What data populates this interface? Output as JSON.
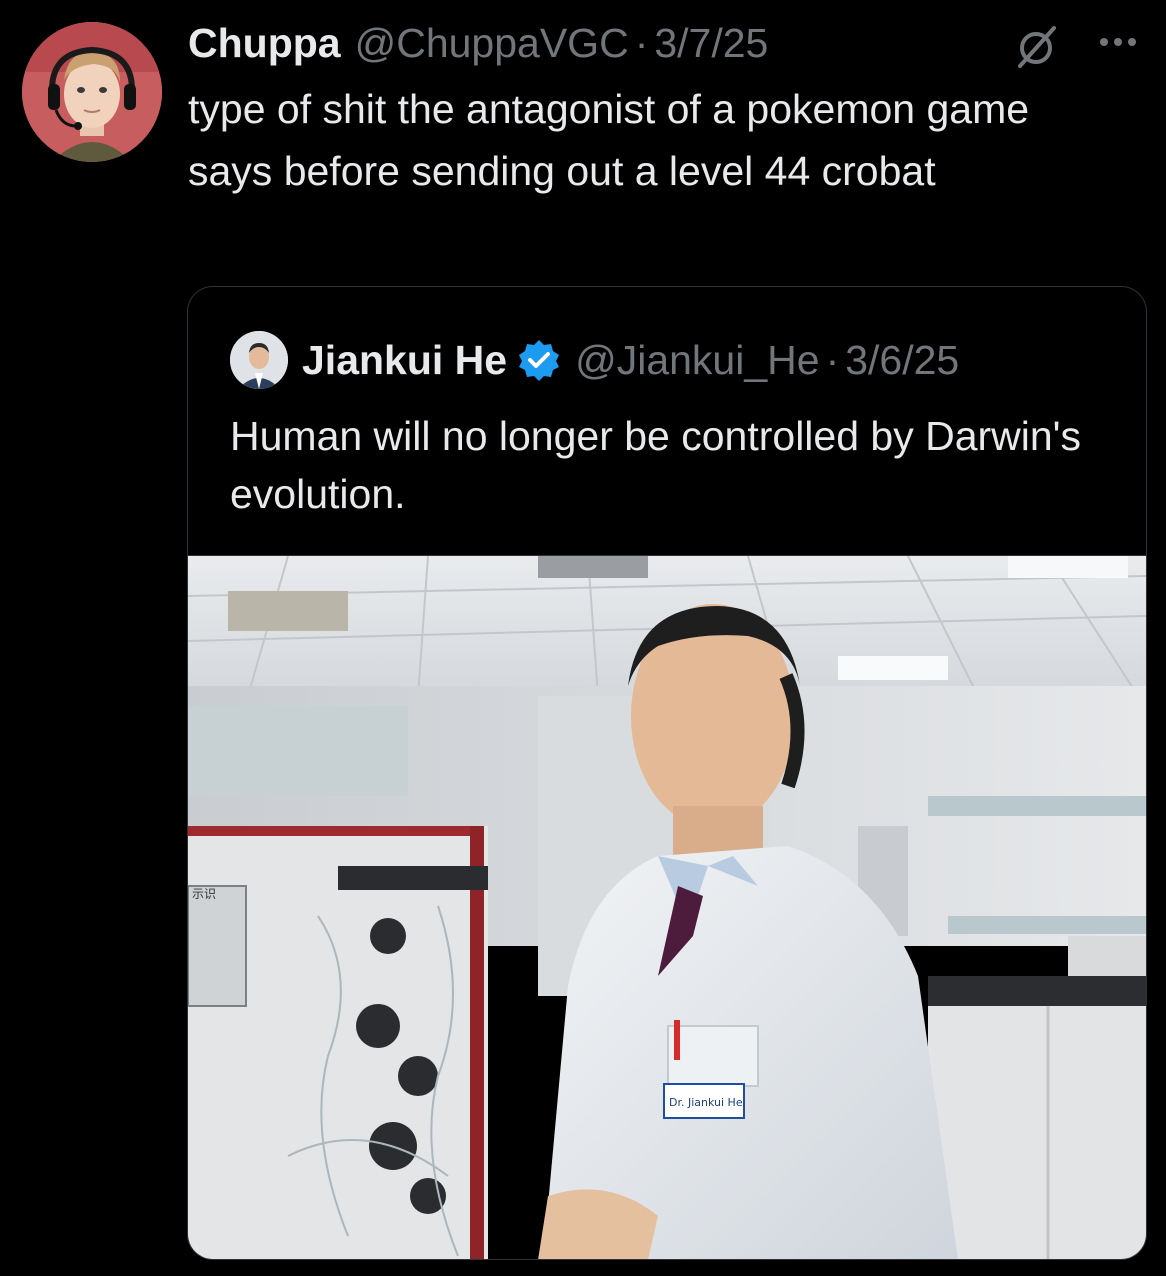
{
  "tweet": {
    "author": {
      "name": "Chuppa",
      "handle": "@ChuppaVGC",
      "date": "3/7/25",
      "separator": "·"
    },
    "text": "type of shit the antagonist of a pokemon game says before sending out a level 44 crobat",
    "icons": [
      "avatar",
      "grok-icon",
      "more-icon"
    ]
  },
  "quote": {
    "author": {
      "name": "Jiankui He",
      "handle": "@Jiankui_He",
      "date": "3/6/25",
      "separator": "·",
      "verified": true
    },
    "text": "Human will no longer be controlled by Darwin's evolution.",
    "image": {
      "name_tag": "Dr. Jiankui He",
      "sign_text": "示识"
    }
  },
  "colors": {
    "background": "#000000",
    "text": "#e7e9ea",
    "secondary": "#71767b",
    "border": "#2f3336",
    "verified": "#1d9bf0"
  }
}
